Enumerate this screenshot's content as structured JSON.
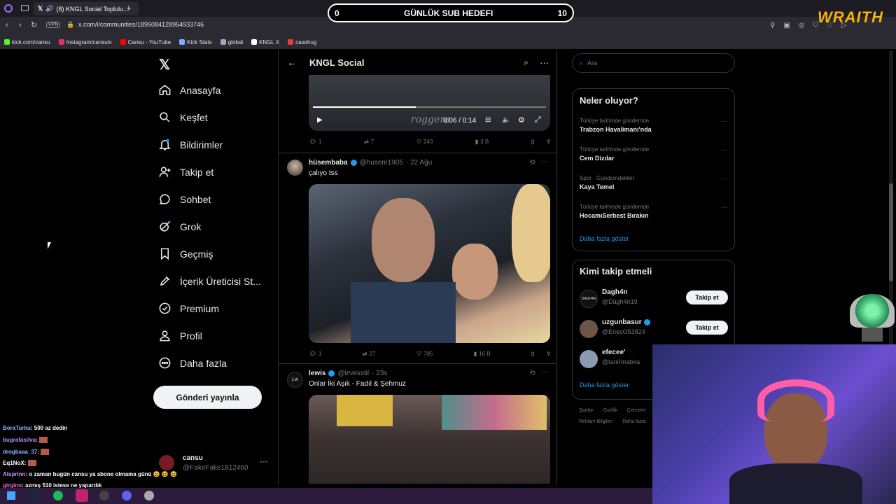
{
  "browser": {
    "tab_title": "(8) KNGL Social Toplulu...",
    "url": "x.com/i/communities/1895084128954933746",
    "vpn": "VPN",
    "bookmarks": [
      "kick.com/cansu",
      "Instagram/cansuiv",
      "Cansu - YouTube",
      "Kick Stats",
      "global",
      "KNGL X",
      "casehug"
    ]
  },
  "overlay": {
    "goal_left": "0",
    "goal_label": "GÜNLÜK SUB HEDEFI",
    "goal_right": "10",
    "brand": "WRAITH"
  },
  "nav": {
    "items": [
      "Anasayfa",
      "Keşfet",
      "Bildirimler",
      "Takip et",
      "Sohbet",
      "Grok",
      "Geçmiş",
      "İçerik Üreticisi St...",
      "Premium",
      "Profil",
      "Daha fazla"
    ],
    "post_button": "Gönderi yayınla",
    "user_name": "cansu",
    "user_handle": "@FakeFake1812460"
  },
  "header": {
    "title": "KNGL Social"
  },
  "video": {
    "time": "0:06 / 0:14",
    "watermark": "roggera"
  },
  "post0_actions": {
    "replies": "1",
    "reposts": "7",
    "likes": "243",
    "views": "3 B"
  },
  "posts": [
    {
      "name": "hüsembaba",
      "handle": "@husem1905",
      "time": "· 22 Ağu",
      "text": "çalıyo tss",
      "replies": "1",
      "reposts": "27",
      "likes": "785",
      "views": "16 B"
    },
    {
      "name": "lewis",
      "handle": "@lewisstil",
      "time": "· 23s",
      "text": "Onlar İki Aşık - Fadıl & Şehmuz"
    }
  ],
  "search": {
    "placeholder": "Ara"
  },
  "trends": {
    "title": "Neler oluyor?",
    "items": [
      {
        "cat": "Türkiye tarihinde gündemde",
        "name": "Trabzon Havalimanı'nda"
      },
      {
        "cat": "Türkiye tarihinde gündemde",
        "name": "Cem Dizdar"
      },
      {
        "cat": "Spor · Gündemdekiler",
        "name": "Kaya Temel"
      },
      {
        "cat": "Türkiye tarihinde gündemde",
        "name": "HocamıSerbest Bırakın"
      }
    ],
    "more": "Daha fazla göster"
  },
  "follow": {
    "title": "Kimi takip etmeli",
    "items": [
      {
        "name": "Dagh4n",
        "handle": "@Dagh4n19",
        "btn": "Takip et"
      },
      {
        "name": "uzgunbasur",
        "handle": "@EnesO53824",
        "btn": "Takip et"
      },
      {
        "name": "efecee'",
        "handle": "@tanrimabira",
        "btn": ""
      }
    ],
    "more": "Daha fazla göster"
  },
  "footer": [
    "Şartlar",
    "Gizlilik",
    "Çerezler",
    "Reklam Bilgileri",
    "Daha fazla"
  ],
  "chat": [
    {
      "user": "BoraTurku",
      "msg": ": 500 az dedin",
      "color": "#8fb3ff"
    },
    {
      "user": "bugrafasilva",
      "msg": ":",
      "color": "#b58cff"
    },
    {
      "user": "drogbaaa_37",
      "msg": ":",
      "color": "#8fb3ff"
    },
    {
      "user": "Eq1NoX",
      "msg": ":",
      "color": "#ffffff"
    },
    {
      "user": "Alsprinn",
      "msg": ": o zaman bugün cansu ya abone olmama günü 😆 😆 😆",
      "color": "#c493ff"
    },
    {
      "user": "girginn",
      "msg": ": azmış 510 istese ne yapardık",
      "color": "#ff6ad5"
    }
  ],
  "colors": {
    "accent": "#1d9bf0",
    "bg": "#000000",
    "border": "#2f3336"
  }
}
